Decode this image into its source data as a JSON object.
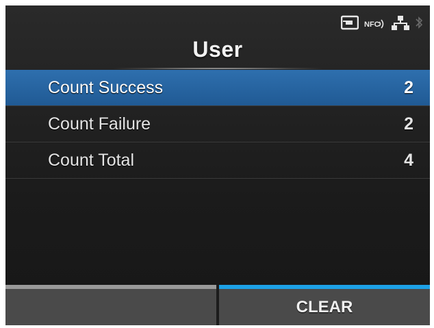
{
  "status_icons": [
    "sd-card-icon",
    "nfc-icon",
    "network-icon",
    "bluetooth-icon"
  ],
  "status": {
    "nfc_label": "NFC"
  },
  "header": {
    "title": "User"
  },
  "list": [
    {
      "label": "Count Success",
      "value": "2",
      "selected": true
    },
    {
      "label": "Count Failure",
      "value": "2",
      "selected": false
    },
    {
      "label": "Count Total",
      "value": "4",
      "selected": false
    }
  ],
  "softkeys": {
    "left_label": "",
    "right_label": "CLEAR"
  },
  "colors": {
    "selection": "#2a69a8",
    "softkey_active": "#1da1e6",
    "softkey_inactive": "#9a9a9a"
  }
}
